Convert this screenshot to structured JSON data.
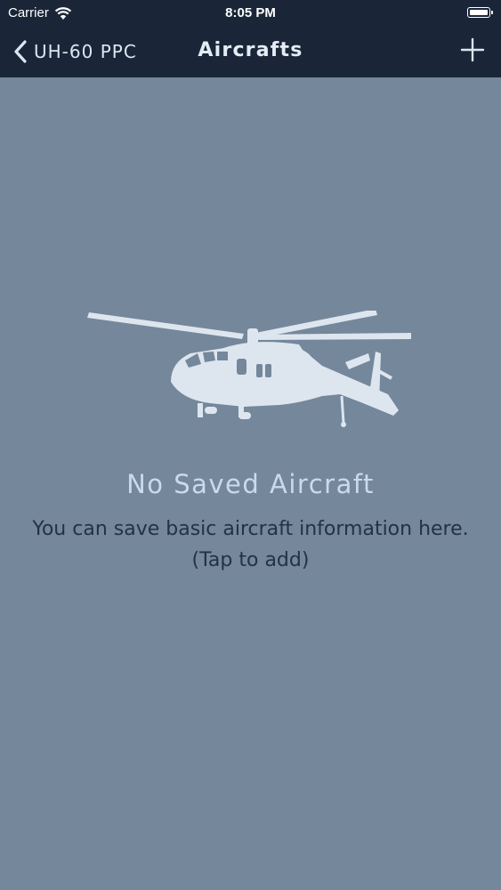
{
  "status_bar": {
    "carrier": "Carrier",
    "time": "8:05 PM"
  },
  "nav": {
    "back_label": "UH-60 PPC",
    "title": "Aircrafts",
    "add_icon": "plus-icon",
    "back_icon": "chevron-left-icon"
  },
  "empty_state": {
    "icon": "helicopter-icon",
    "title": "No Saved Aircraft",
    "message_line1": "You can save basic aircraft information here.",
    "message_line2": "(Tap to add)"
  },
  "colors": {
    "bar": "#1a2638",
    "background": "#75879b",
    "title": "#c9daf0",
    "message": "#233246",
    "illustration": "#dde6ef"
  }
}
